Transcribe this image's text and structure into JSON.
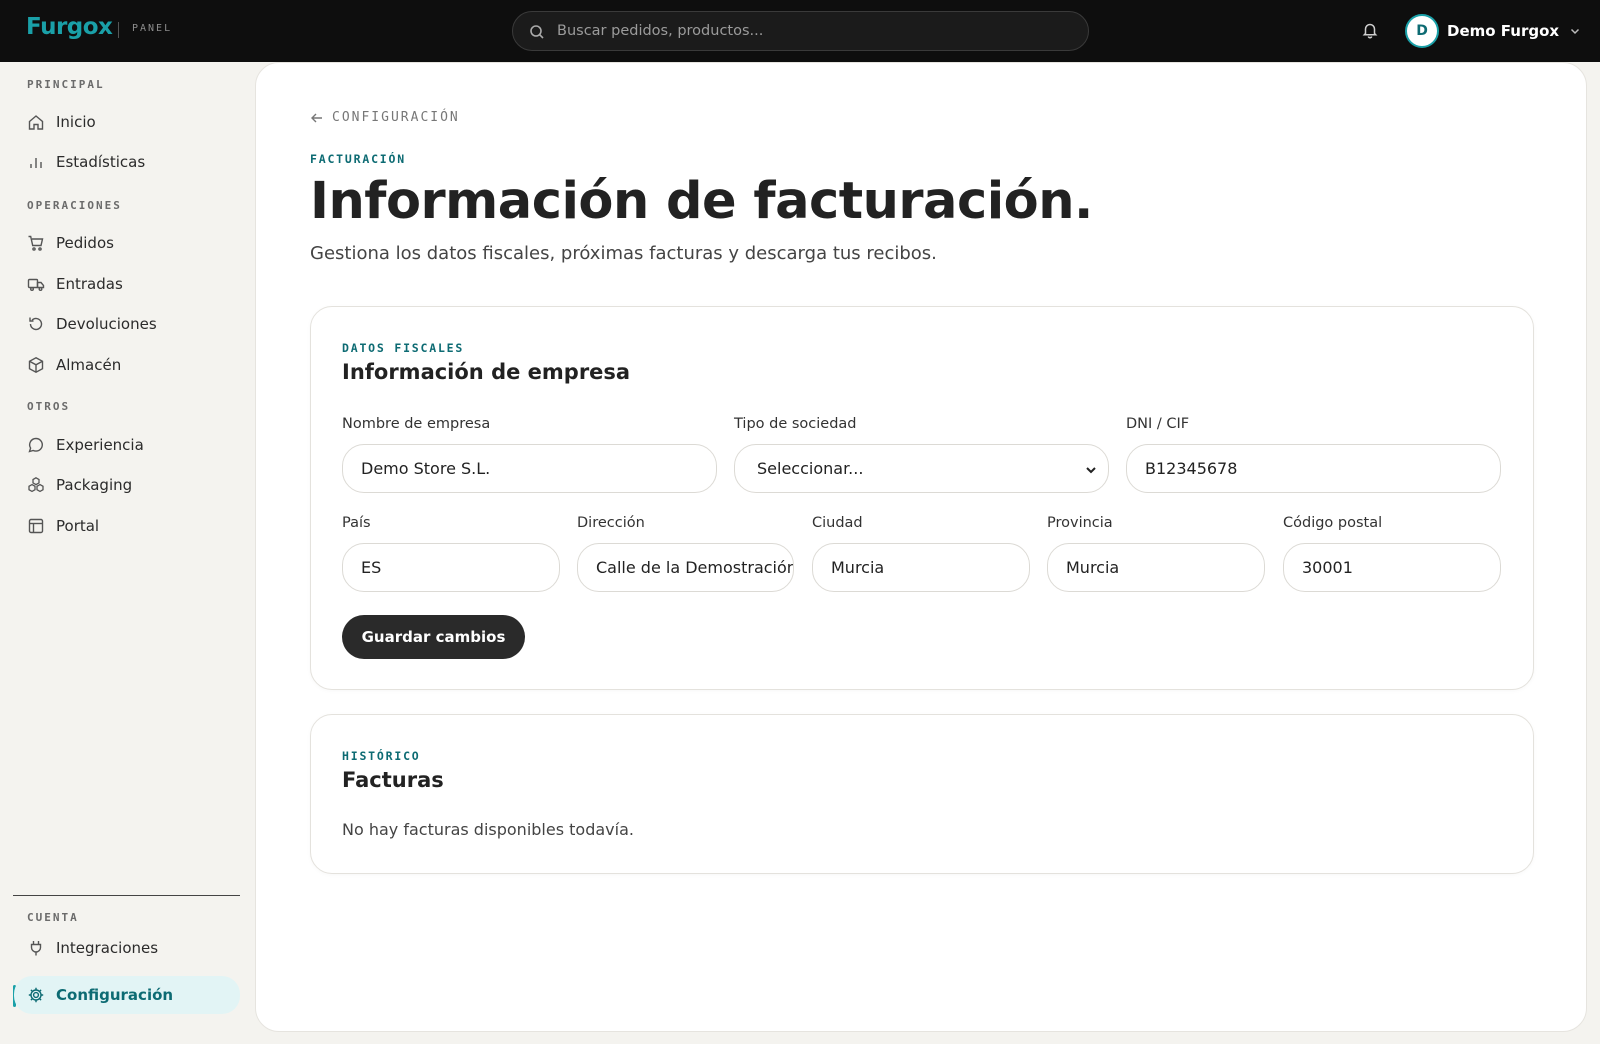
{
  "topbar": {
    "logo": "Furgox",
    "panel_tag": "PANEL",
    "search_placeholder": "Buscar pedidos, productos...",
    "user_initial": "D",
    "user_name": "Demo Furgox"
  },
  "sidebar": {
    "sections": {
      "principal": "PRINCIPAL",
      "operaciones": "OPERACIONES",
      "otros": "OTROS",
      "cuenta": "CUENTA"
    },
    "items": {
      "inicio": "Inicio",
      "estadisticas": "Estadísticas",
      "pedidos": "Pedidos",
      "entradas": "Entradas",
      "devoluciones": "Devoluciones",
      "almacen": "Almacén",
      "experiencia": "Experiencia",
      "packaging": "Packaging",
      "portal": "Portal",
      "integraciones": "Integraciones",
      "configuracion": "Configuración"
    },
    "active_item": "configuracion"
  },
  "main": {
    "back_label": "CONFIGURACIÓN",
    "eyebrow": "FACTURACIÓN",
    "title": "Información de facturación.",
    "subtitle": "Gestiona los datos fiscales, próximas facturas y descarga tus recibos."
  },
  "company_card": {
    "eyebrow": "DATOS FISCALES",
    "title": "Información de empresa",
    "fields": {
      "company_name": {
        "label": "Nombre de empresa",
        "value": "Demo Store S.L."
      },
      "company_type": {
        "label": "Tipo de sociedad",
        "value": "Seleccionar..."
      },
      "tax_id": {
        "label": "DNI / CIF",
        "value": "B12345678"
      },
      "country": {
        "label": "País",
        "value": "ES"
      },
      "address": {
        "label": "Dirección",
        "value": "Calle de la Demostración"
      },
      "city": {
        "label": "Ciudad",
        "value": "Murcia"
      },
      "province": {
        "label": "Provincia",
        "value": "Murcia"
      },
      "postal_code": {
        "label": "Código postal",
        "value": "30001"
      }
    },
    "save_label": "Guardar cambios"
  },
  "invoices_card": {
    "eyebrow": "HISTÓRICO",
    "title": "Facturas",
    "empty_text": "No hay facturas disponibles todavía."
  },
  "colors": {
    "accent": "#1aa0a8",
    "accent_dark": "#0d6b73",
    "topbar_bg": "#0e0e0e",
    "sidebar_bg": "#f4f3ef",
    "active_bg": "#e2f4f5",
    "button_bg": "#2a2a2a"
  }
}
